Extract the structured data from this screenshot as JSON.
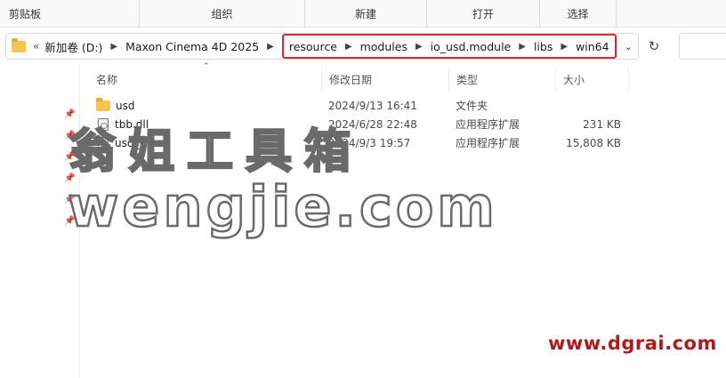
{
  "ribbon": {
    "clipboard": "剪贴板",
    "organize": "组织",
    "new": "新建",
    "open": "打开",
    "select": "选择"
  },
  "address": {
    "overflow": "«",
    "crumbs": [
      "新加卷 (D:)",
      "Maxon Cinema 4D 2025"
    ],
    "highlighted_crumbs": [
      "resource",
      "modules",
      "io_usd.module",
      "libs",
      "win64"
    ],
    "highlight_color": "#e0262b",
    "refresh_icon": "refresh-icon"
  },
  "columns": {
    "name": "名称",
    "date": "修改日期",
    "type": "类型",
    "size": "大小"
  },
  "files": [
    {
      "name": "usd",
      "date": "2024/9/13 16:41",
      "type": "文件夹",
      "size": "",
      "icon": "folder-icon"
    },
    {
      "name": "tbb.dll",
      "date": "2024/6/28 22:48",
      "type": "应用程序扩展",
      "size": "231 KB",
      "icon": "dll-file-icon"
    },
    {
      "name": "usd_ms.dll",
      "date": "2024/9/3 19:57",
      "type": "应用程序扩展",
      "size": "15,808 KB",
      "icon": "dll-file-icon"
    }
  ],
  "watermarks": {
    "chinese": "翁姐工具箱",
    "url": "wengjie.com",
    "site": "www.dgrai.com",
    "site_color": "#b21a1a"
  }
}
